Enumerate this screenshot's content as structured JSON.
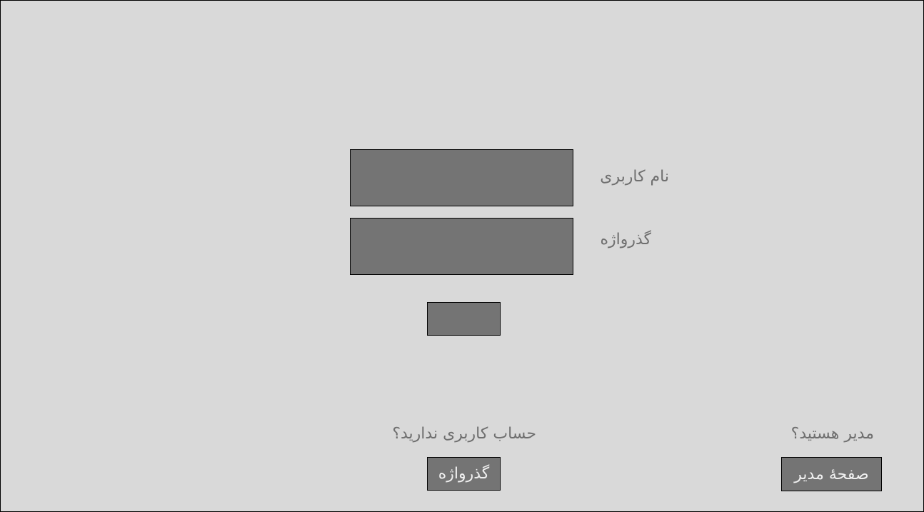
{
  "login_form": {
    "username_label": "نام کاربری",
    "username_value": "",
    "password_label": "گذرواژه",
    "password_value": "",
    "submit_label": ""
  },
  "signup": {
    "prompt": "حساب کاربری ندارید؟",
    "button_label": "گذرواژه"
  },
  "admin": {
    "prompt": "مدیر هستید؟",
    "button_label": "صفحهٔ مدیر"
  },
  "colors": {
    "background": "#d9d9d9",
    "control_fill": "#747474",
    "label_text": "#6f6f6f",
    "button_text": "#efefef"
  }
}
